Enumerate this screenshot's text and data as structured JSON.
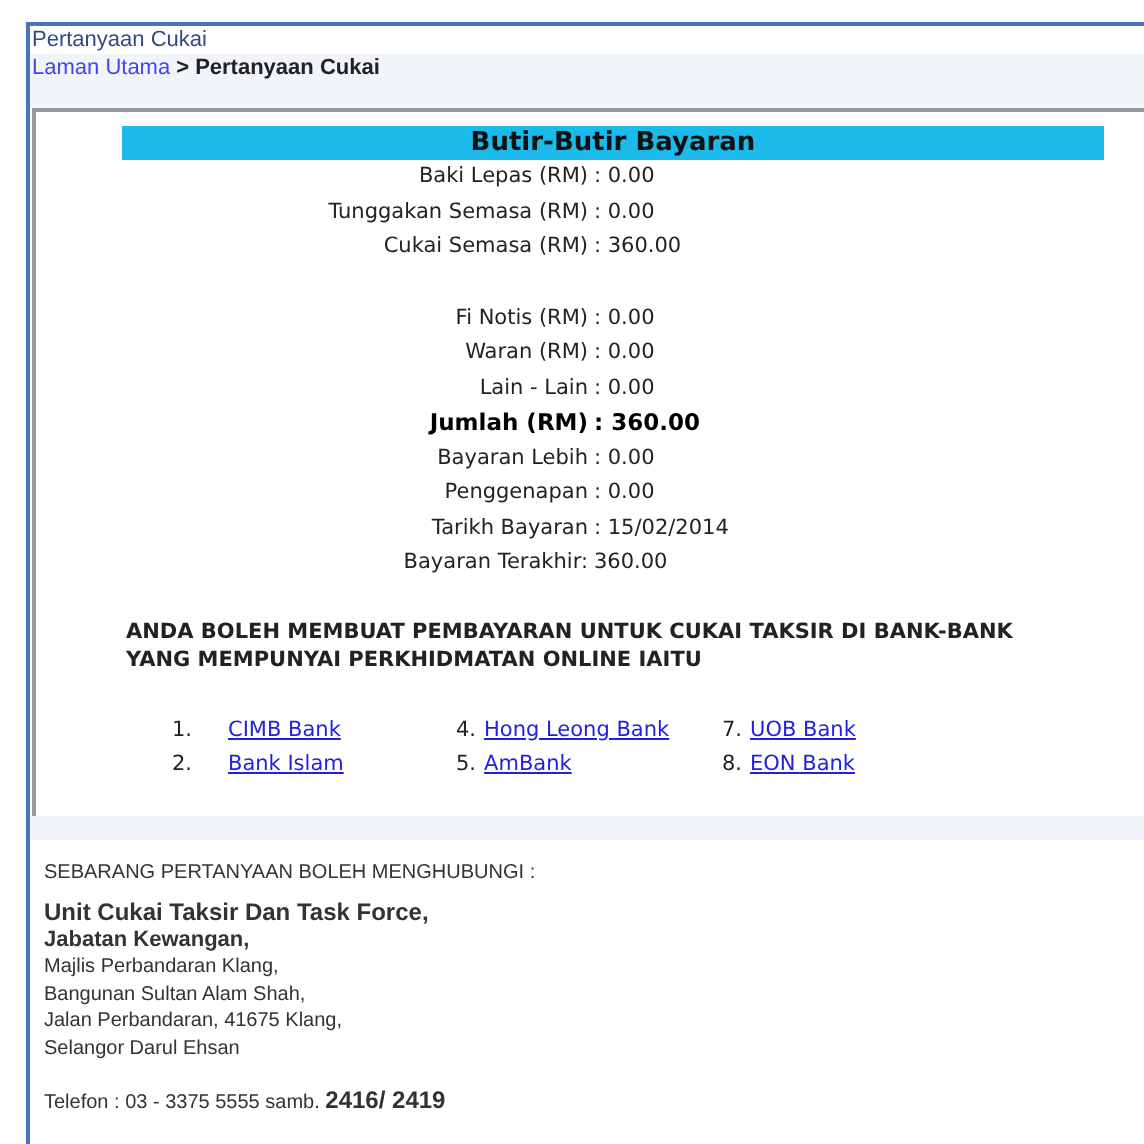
{
  "page_title": "Pertanyaan Cukai",
  "breadcrumb": {
    "link": "Laman Utama",
    "current": "> Pertanyaan Cukai"
  },
  "details": {
    "heading": "Butir-Butir Bayaran",
    "groups": [
      [
        {
          "label": "Baki Lepas (RM)",
          "value": ": 0.00",
          "bold": false
        },
        {
          "label": "Tunggakan Semasa (RM)",
          "value": ": 0.00",
          "bold": false
        },
        {
          "label": "Cukai Semasa (RM)",
          "value": ": 360.00",
          "bold": false
        }
      ],
      [
        {
          "label": "Fi Notis (RM)",
          "value": ": 0.00",
          "bold": false
        },
        {
          "label": "Waran (RM)",
          "value": ": 0.00",
          "bold": false
        },
        {
          "label": "Lain - Lain",
          "value": ": 0.00",
          "bold": false
        },
        {
          "label": "Jumlah (RM)",
          "value": ": 360.00",
          "bold": true
        },
        {
          "label": "Bayaran Lebih",
          "value": ": 0.00",
          "bold": false
        },
        {
          "label": "Penggenapan",
          "value": ": 0.00",
          "bold": false
        },
        {
          "label": "Tarikh Bayaran",
          "value": ": 15/02/2014",
          "bold": false
        },
        {
          "label": "Bayaran Terakhir:",
          "value": "360.00",
          "bold": false
        }
      ]
    ]
  },
  "banks_notice": "ANDA BOLEH MEMBUAT PEMBAYARAN UNTUK CUKAI TAKSIR DI BANK-BANK YANG MEMPUNYAI PERKHIDMATAN ONLINE IAITU",
  "bank_columns": [
    [
      {
        "number": "1.",
        "name": "CIMB Bank"
      },
      {
        "number": "2.",
        "name": "Bank Islam"
      }
    ],
    [
      {
        "number": "4.",
        "name": "Hong Leong Bank"
      },
      {
        "number": "5.",
        "name": "AmBank"
      }
    ],
    [
      {
        "number": "7.",
        "name": "UOB Bank"
      },
      {
        "number": "8.",
        "name": "EON Bank"
      }
    ]
  ],
  "contact": {
    "intro": "SEBARANG PERTANYAAN BOLEH MENGHUBUNGI :",
    "unit": "Unit Cukai Taksir Dan Task Force,",
    "department": "Jabatan Kewangan,",
    "address": [
      "Majlis Perbandaran Klang,",
      "Bangunan Sultan Alam Shah,",
      "Jalan Perbandaran, 41675 Klang,",
      "Selangor Darul Ehsan"
    ],
    "phone": "Telefon : 03 - 3375 5555 samb. **2416/ 2419**"
  }
}
